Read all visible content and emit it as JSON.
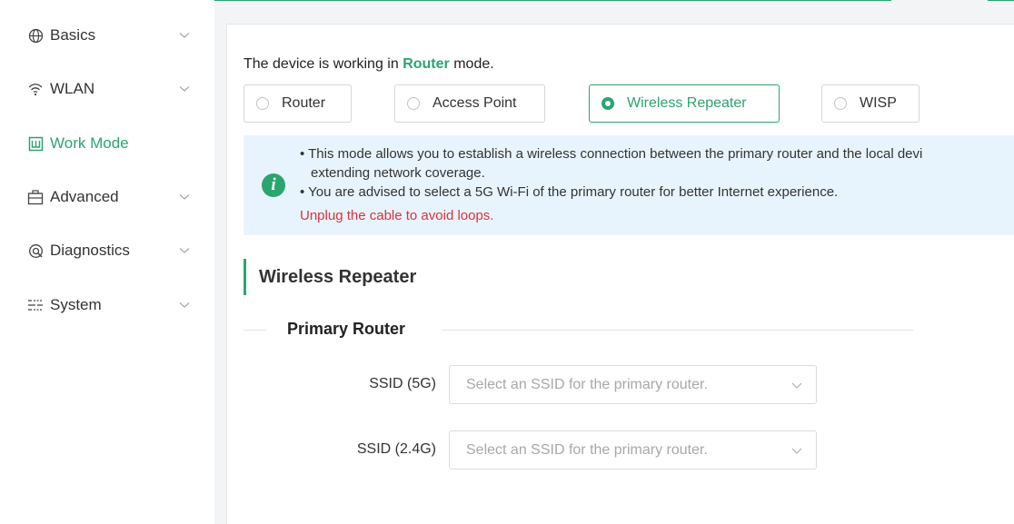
{
  "sidebar": {
    "items": [
      {
        "label": "Basics",
        "icon": "globe-icon"
      },
      {
        "label": "WLAN",
        "icon": "wifi-icon"
      },
      {
        "label": "Work Mode",
        "icon": "work-mode-icon"
      },
      {
        "label": "Advanced",
        "icon": "advanced-icon"
      },
      {
        "label": "Diagnostics",
        "icon": "diagnostics-icon"
      },
      {
        "label": "System",
        "icon": "system-icon"
      }
    ],
    "active": "Work Mode"
  },
  "status": {
    "prefix": "The device is working in",
    "mode": "Router",
    "suffix": "mode."
  },
  "modes": {
    "router": "Router",
    "access_point": "Access Point",
    "wireless_repeater": "Wireless Repeater",
    "wisp": "WISP",
    "selected": "Wireless Repeater"
  },
  "info": {
    "line1": "• This mode allows you to establish a wireless connection between the primary router and the local devi",
    "line2": "extending network coverage.",
    "line3": "• You are advised to select a 5G Wi-Fi of the primary router for better Internet experience.",
    "warning": "Unplug the cable to avoid loops."
  },
  "section": {
    "title": "Wireless Repeater",
    "subtitle": "Primary Router"
  },
  "fields": {
    "ssid_5g_label": "SSID (5G)",
    "ssid_5g_placeholder": "Select an SSID for the primary router.",
    "ssid_24g_label": "SSID (2.4G)",
    "ssid_24g_placeholder": "Select an SSID for the primary router."
  },
  "colors": {
    "accent": "#2aa56f",
    "warning": "#e0303a",
    "info_bg": "#e8f4fd"
  }
}
